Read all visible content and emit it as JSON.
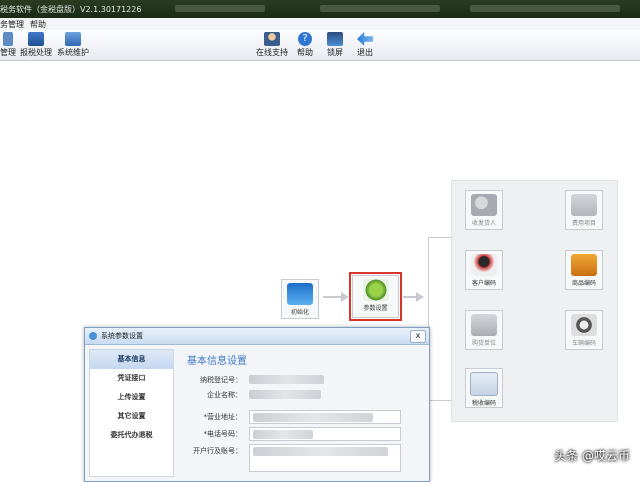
{
  "window": {
    "title": "税务软件（金税盘版）V2.1.30171226"
  },
  "menu": [
    {
      "label": "务管理"
    },
    {
      "label": "帮助"
    }
  ],
  "toolbar": {
    "left": [
      {
        "label": "管理",
        "icon": "manage-icon"
      },
      {
        "label": "报税处理",
        "icon": "tax-report-icon"
      },
      {
        "label": "系统维护",
        "icon": "system-maintenance-icon"
      }
    ],
    "right": [
      {
        "label": "在线支持",
        "icon": "online-support-icon"
      },
      {
        "label": "帮助",
        "icon": "help-icon"
      },
      {
        "label": "锁屏",
        "icon": "lock-screen-icon"
      },
      {
        "label": "退出",
        "icon": "exit-icon"
      }
    ]
  },
  "flow": {
    "init": "初始化",
    "params": "参数设置",
    "nodes": [
      "收发货人",
      "费用项目",
      "客户编码",
      "商品编码",
      "购货单位",
      "车辆编码",
      "税收编码"
    ]
  },
  "dialog": {
    "title": "系统参数设置",
    "close": "x",
    "nav": [
      "基本信息",
      "凭证接口",
      "上传设置",
      "其它设置",
      "委托代办退税"
    ],
    "heading": "基本信息设置",
    "fields": {
      "tax_id": "纳税登记号：",
      "company": "企业名称：",
      "address": "*营业地址：",
      "phone": "*电话号码：",
      "bank": "开户行及账号："
    }
  },
  "watermark": "头条 @哎云币"
}
